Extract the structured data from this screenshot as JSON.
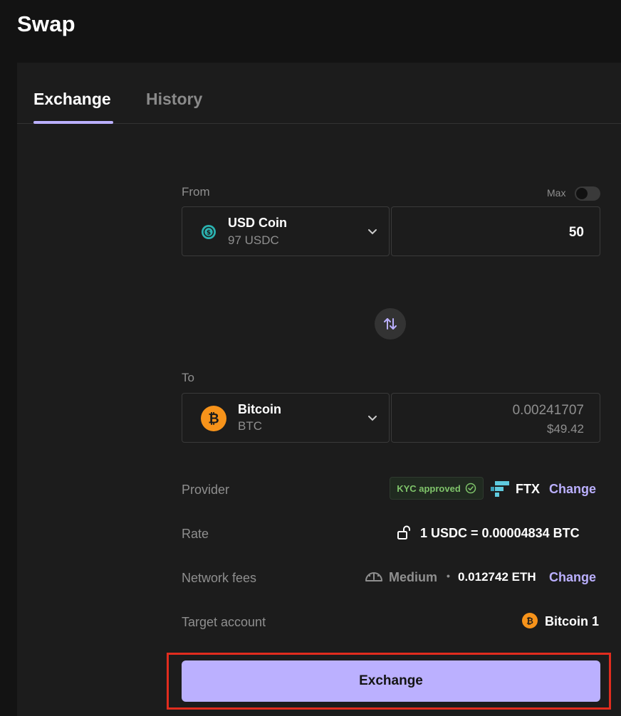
{
  "page": {
    "title": "Swap"
  },
  "tabs": [
    {
      "label": "Exchange",
      "active": true
    },
    {
      "label": "History",
      "active": false
    }
  ],
  "from": {
    "label": "From",
    "max_label": "Max",
    "max_enabled": false,
    "coin_name": "USD Coin",
    "coin_balance": "97 USDC",
    "icon": "usdc-icon",
    "amount": "50"
  },
  "to": {
    "label": "To",
    "coin_name": "Bitcoin",
    "coin_ticker": "BTC",
    "icon": "bitcoin-icon",
    "amount": "0.00241707",
    "fiat_value": "$49.42"
  },
  "details": {
    "provider": {
      "label": "Provider",
      "kyc_badge": "KYC approved",
      "name": "FTX",
      "change_label": "Change"
    },
    "rate": {
      "label": "Rate",
      "value": "1 USDC = 0.00004834 BTC",
      "icon": "unlock-icon"
    },
    "network_fees": {
      "label": "Network fees",
      "speed": "Medium",
      "separator": "•",
      "value": "0.012742 ETH",
      "change_label": "Change",
      "icon": "speedometer-icon"
    },
    "target_account": {
      "label": "Target account",
      "value": "Bitcoin 1",
      "icon": "bitcoin-icon"
    }
  },
  "actions": {
    "exchange_label": "Exchange"
  },
  "colors": {
    "background": "#131313",
    "panel": "#1c1c1c",
    "accent": "#bbb0ff",
    "kyc_green": "#7fc46a",
    "bitcoin_orange": "#f7931a",
    "usdc_teal": "#2bb3b1",
    "highlight_red": "#e12c1e"
  }
}
